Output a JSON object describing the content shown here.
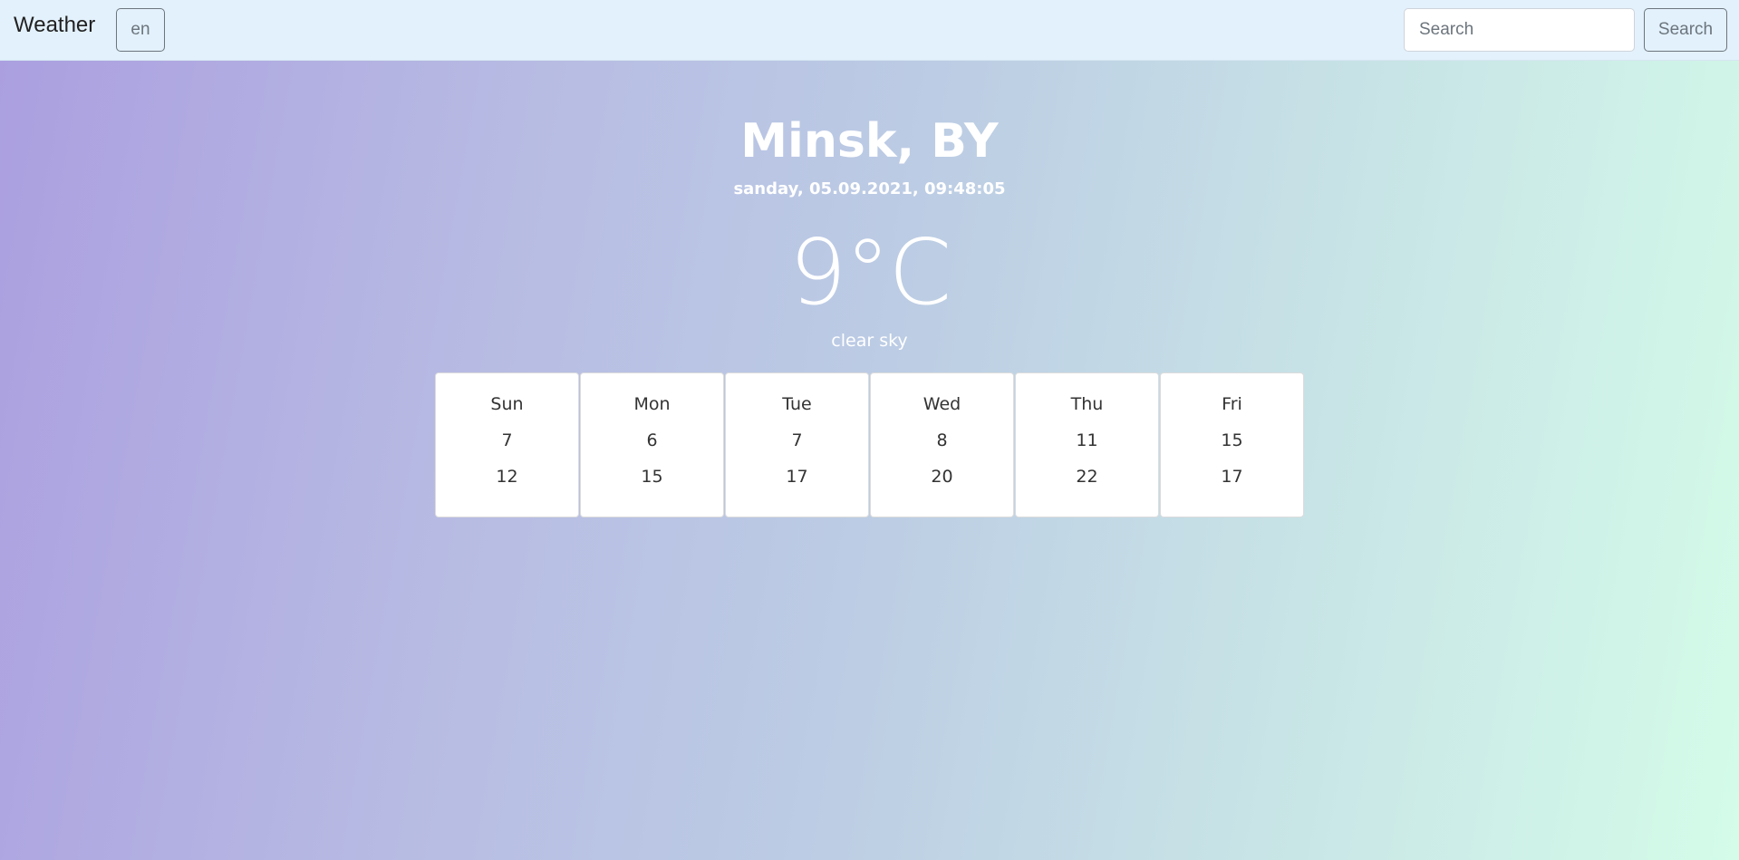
{
  "header": {
    "brand": "Weather",
    "language": "en",
    "search_placeholder": "Search",
    "search_button": "Search"
  },
  "current": {
    "city": "Minsk, BY",
    "datetime": "sanday, 05.09.2021, 09:48:05",
    "temperature": "9°C",
    "description": "clear sky"
  },
  "forecast": [
    {
      "day": "Sun",
      "min": "7",
      "max": "12"
    },
    {
      "day": "Mon",
      "min": "6",
      "max": "15"
    },
    {
      "day": "Tue",
      "min": "7",
      "max": "17"
    },
    {
      "day": "Wed",
      "min": "8",
      "max": "20"
    },
    {
      "day": "Thu",
      "min": "11",
      "max": "22"
    },
    {
      "day": "Fri",
      "min": "15",
      "max": "17"
    }
  ],
  "colors": {
    "navbar_bg": "#e3f1fc",
    "gradient_start": "#ab9fe0",
    "gradient_end": "#d4fce9"
  }
}
